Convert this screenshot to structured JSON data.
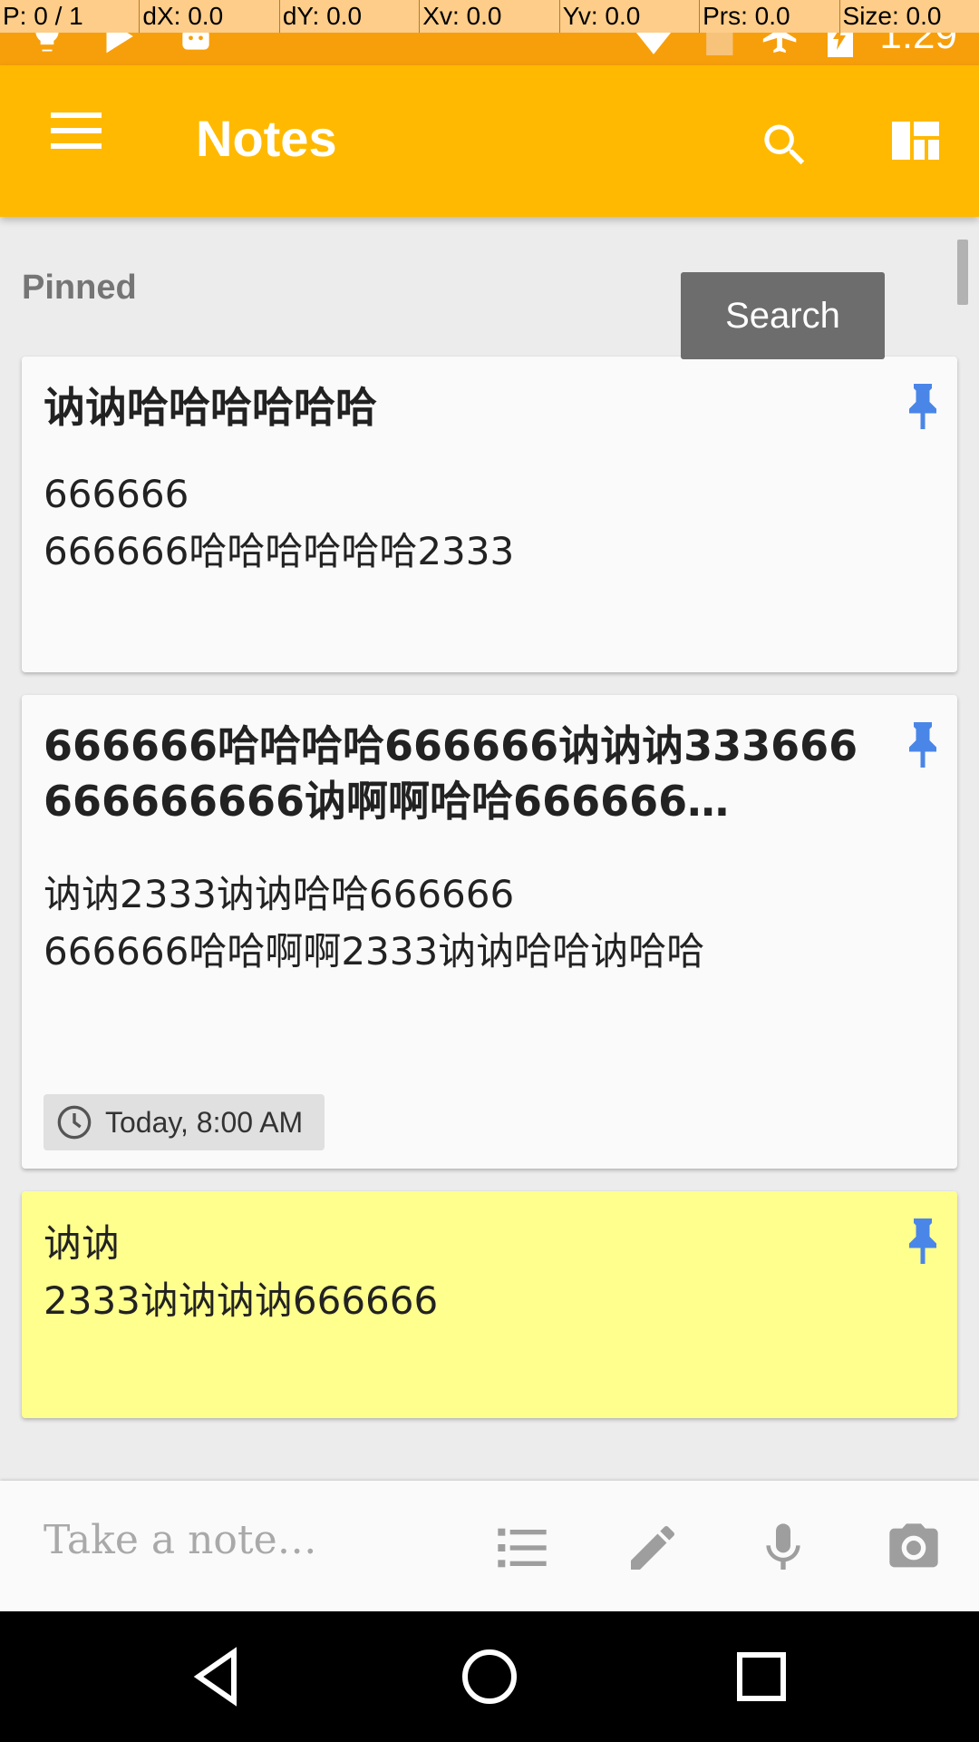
{
  "status_bar": {
    "pointer_info": [
      "P: 0 / 1",
      "dX: 0.0",
      "dY: 0.0",
      "Xv: 0.0",
      "Yv: 0.0",
      "Prs: 0.0",
      "Size: 0.0"
    ],
    "time": "1:29",
    "icons": [
      "bulb-icon",
      "play-store-icon",
      "android-icon",
      "wifi-icon",
      "sim-icon",
      "airplane-icon",
      "battery-charging-icon"
    ]
  },
  "app_bar": {
    "title": "Notes",
    "menu_icon": "hamburger-menu-icon",
    "search_icon": "search-icon",
    "layout_icon": "grid-layout-icon"
  },
  "tooltip": {
    "text": "Search"
  },
  "section": {
    "label": "Pinned"
  },
  "notes": [
    {
      "title": "讷讷哈哈哈哈哈哈",
      "body": "666666\n666666哈哈哈哈哈哈2333",
      "pinned": true,
      "color": "#fafafa"
    },
    {
      "title": "666666哈哈哈哈666666讷讷讷333666666666666讷啊啊哈哈666666…",
      "body": "讷讷2333讷讷哈哈666666\n666666哈哈啊啊2333讷讷哈哈讷哈哈",
      "reminder": "Today, 8:00 AM",
      "pinned": true,
      "color": "#fafafa"
    },
    {
      "title": "",
      "body": "讷讷\n2333讷讷讷讷666666",
      "pinned": true,
      "color": "#ffff8d"
    }
  ],
  "bottom_bar": {
    "placeholder": "Take a note…",
    "icons": [
      "list-icon",
      "pencil-icon",
      "microphone-icon",
      "camera-icon"
    ]
  },
  "nav_bar": {
    "icons": [
      "back-icon",
      "home-icon",
      "recents-icon"
    ]
  },
  "colors": {
    "status_bar": "#f79f0a",
    "app_bar": "#ffb900",
    "pin": "#4a86e8",
    "yellow_note": "#ffff8d"
  }
}
